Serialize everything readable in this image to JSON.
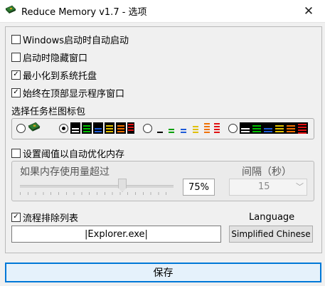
{
  "window": {
    "title": "Reduce Memory v1.7 - 选项",
    "close_glyph": "✕",
    "app_icon": "memory-chip-icon"
  },
  "options": {
    "start_with_windows": {
      "label": "Windows启动时自动启动",
      "checked": false
    },
    "hide_window_on_start": {
      "label": "启动时隐藏窗口",
      "checked": false
    },
    "minimize_to_tray": {
      "label": "最小化到系统托盘",
      "checked": true
    },
    "always_on_top": {
      "label": "始终在顶部显示程序窗口",
      "checked": true
    }
  },
  "tray_icon": {
    "label": "选择任务栏图标包",
    "selected_index": 1,
    "choices": [
      "memory-chip-icon",
      "colored-bars-icon",
      "small-bars-icon",
      "dark-bars-icon"
    ]
  },
  "auto_optimize": {
    "label": "设置阈值以自动优化内存",
    "checked": false,
    "usage_label": "如果内存使用量超过",
    "usage_value": "75%",
    "usage_level": 0.75,
    "interval_label": "间隔（秒）",
    "interval_value": "15",
    "enabled": false
  },
  "exclusion": {
    "label": "流程排除列表",
    "checked": true,
    "value": "|Explorer.exe|"
  },
  "language": {
    "label": "Language",
    "value": "Simplified Chinese"
  },
  "save_label": "保存",
  "colors": {
    "accent": "#0078d7",
    "window_bg": "#f0f0f0"
  }
}
